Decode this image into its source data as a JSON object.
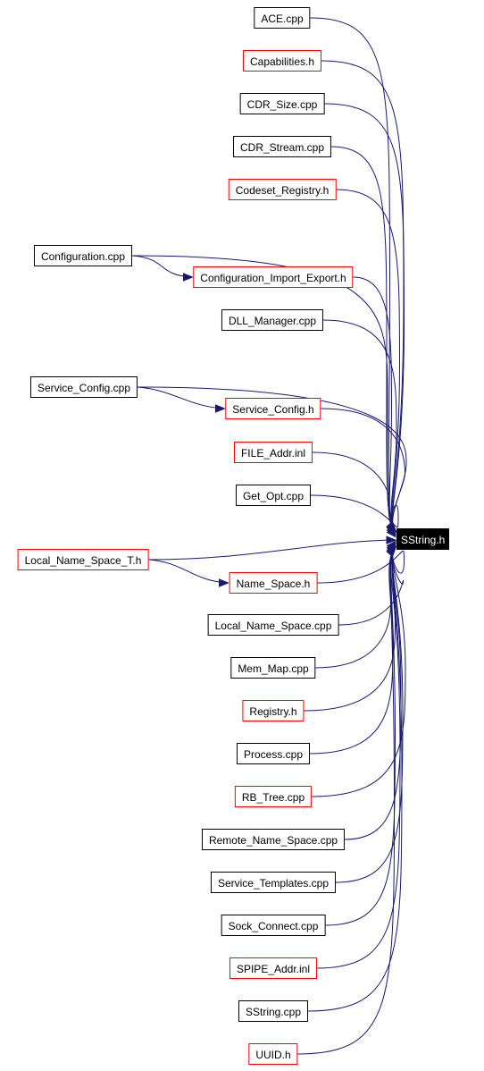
{
  "colors": {
    "edge": "#191970",
    "incomplete_border": "#ff0000",
    "complete_border": "#000000",
    "target_fill": "#000000"
  },
  "target": {
    "id": "sstring_h",
    "label": "SString.h"
  },
  "nodes": [
    {
      "id": "ace_cpp",
      "label": "ACE.cpp",
      "red": false
    },
    {
      "id": "capabilities_h",
      "label": "Capabilities.h",
      "red": true
    },
    {
      "id": "cdr_size_cpp",
      "label": "CDR_Size.cpp",
      "red": false
    },
    {
      "id": "cdr_stream_cpp",
      "label": "CDR_Stream.cpp",
      "red": false
    },
    {
      "id": "codeset_registry_h",
      "label": "Codeset_Registry.h",
      "red": true
    },
    {
      "id": "configuration_cpp",
      "label": "Configuration.cpp",
      "red": false
    },
    {
      "id": "configuration_import_export_h",
      "label": "Configuration_Import_Export.h",
      "red": true
    },
    {
      "id": "dll_manager_cpp",
      "label": "DLL_Manager.cpp",
      "red": false
    },
    {
      "id": "service_config_cpp",
      "label": "Service_Config.cpp",
      "red": false
    },
    {
      "id": "service_config_h",
      "label": "Service_Config.h",
      "red": true
    },
    {
      "id": "file_addr_inl",
      "label": "FILE_Addr.inl",
      "red": true
    },
    {
      "id": "get_opt_cpp",
      "label": "Get_Opt.cpp",
      "red": false
    },
    {
      "id": "local_name_space_t_h",
      "label": "Local_Name_Space_T.h",
      "red": true
    },
    {
      "id": "name_space_h",
      "label": "Name_Space.h",
      "red": true
    },
    {
      "id": "local_name_space_cpp",
      "label": "Local_Name_Space.cpp",
      "red": false
    },
    {
      "id": "mem_map_cpp",
      "label": "Mem_Map.cpp",
      "red": false
    },
    {
      "id": "registry_h",
      "label": "Registry.h",
      "red": true
    },
    {
      "id": "process_cpp",
      "label": "Process.cpp",
      "red": false
    },
    {
      "id": "rb_tree_cpp",
      "label": "RB_Tree.cpp",
      "red": true
    },
    {
      "id": "remote_name_space_cpp",
      "label": "Remote_Name_Space.cpp",
      "red": false
    },
    {
      "id": "service_templates_cpp",
      "label": "Service_Templates.cpp",
      "red": false
    },
    {
      "id": "sock_connect_cpp",
      "label": "Sock_Connect.cpp",
      "red": false
    },
    {
      "id": "spipe_addr_inl",
      "label": "SPIPE_Addr.inl",
      "red": true
    },
    {
      "id": "sstring_cpp",
      "label": "SString.cpp",
      "red": false
    },
    {
      "id": "uuid_h",
      "label": "UUID.h",
      "red": true
    }
  ],
  "edges": [
    [
      "ace_cpp",
      "sstring_h"
    ],
    [
      "capabilities_h",
      "sstring_h"
    ],
    [
      "cdr_size_cpp",
      "sstring_h"
    ],
    [
      "cdr_stream_cpp",
      "sstring_h"
    ],
    [
      "codeset_registry_h",
      "sstring_h"
    ],
    [
      "configuration_cpp",
      "sstring_h"
    ],
    [
      "configuration_cpp",
      "configuration_import_export_h"
    ],
    [
      "configuration_import_export_h",
      "sstring_h"
    ],
    [
      "dll_manager_cpp",
      "sstring_h"
    ],
    [
      "service_config_cpp",
      "sstring_h"
    ],
    [
      "service_config_cpp",
      "service_config_h"
    ],
    [
      "service_config_h",
      "sstring_h"
    ],
    [
      "file_addr_inl",
      "sstring_h"
    ],
    [
      "get_opt_cpp",
      "sstring_h"
    ],
    [
      "local_name_space_t_h",
      "sstring_h"
    ],
    [
      "local_name_space_t_h",
      "name_space_h"
    ],
    [
      "name_space_h",
      "sstring_h"
    ],
    [
      "local_name_space_cpp",
      "sstring_h"
    ],
    [
      "mem_map_cpp",
      "sstring_h"
    ],
    [
      "registry_h",
      "sstring_h"
    ],
    [
      "process_cpp",
      "sstring_h"
    ],
    [
      "rb_tree_cpp",
      "sstring_h"
    ],
    [
      "remote_name_space_cpp",
      "sstring_h"
    ],
    [
      "service_templates_cpp",
      "sstring_h"
    ],
    [
      "sock_connect_cpp",
      "sstring_h"
    ],
    [
      "spipe_addr_inl",
      "sstring_h"
    ],
    [
      "sstring_cpp",
      "sstring_h"
    ],
    [
      "uuid_h",
      "sstring_h"
    ]
  ]
}
